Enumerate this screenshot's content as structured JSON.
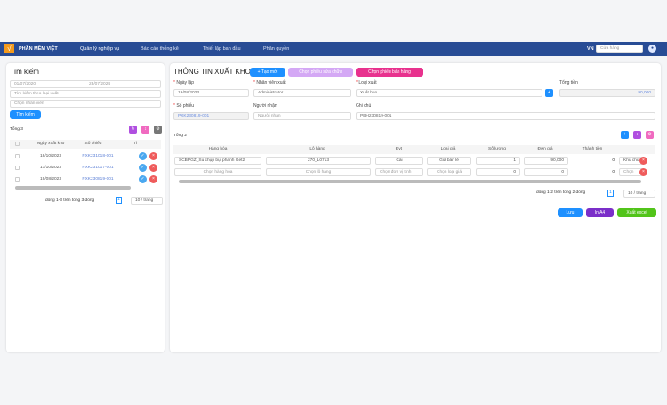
{
  "nav": {
    "brand": "PHẦN MỀM VIỆT",
    "items": [
      "Quản lý nghiệp vụ",
      "Báo cáo thống kê",
      "Thiết lập ban đầu",
      "Phân quyền"
    ],
    "lang": "VN",
    "store_placeholder": "Cửa hàng"
  },
  "left": {
    "title": "Tìm kiếm",
    "date_from": "01/07/2020",
    "date_to": "23/07/2024",
    "type_placeholder": "Tìm kiếm theo loại xuất",
    "staff_placeholder": "Chọn nhân viên",
    "search_button": "Tìm kiếm",
    "total": "Tổng 3",
    "columns": [
      "Ngày xuất kho",
      "Số phiếu",
      "Tì"
    ],
    "rows": [
      {
        "date": "18/10/2023",
        "code": "PXK231018-001"
      },
      {
        "date": "17/10/2023",
        "code": "PXK231017-001"
      },
      {
        "date": "19/08/2023",
        "code": "PXK230819-001"
      }
    ],
    "pagination": "dòng 1-3 trên tổng 3 dòng",
    "page": "1",
    "page_size": "10 / trang"
  },
  "main": {
    "title": "THÔNG TIN XUẤT KHO",
    "new_button": "+ Tạo mới",
    "repair_button": "Chọn phiếu sửa chữa",
    "sale_button": "Chọn phiếu bán hàng",
    "date_label": "Ngày lập",
    "date_value": "19/08/2023",
    "staff_label": "Nhân viên xuất",
    "staff_value": "Administrator",
    "type_label": "Loại xuất",
    "type_value": "Xuất bán",
    "total_label": "Tổng tiền",
    "total_value": "90,000",
    "code_label": "Số phiếu",
    "code_value": "PXK230819-001",
    "receiver_label": "Người nhận",
    "receiver_placeholder": "Người nhận",
    "note_label": "Ghi chú",
    "note_value": "PBH230819-001",
    "count": "Tổng 2",
    "columns": [
      "Hàng hóa",
      "Lô hàng",
      "Đvt",
      "Loại giá",
      "Số lượng",
      "Đơn giá",
      "Thành tiền"
    ],
    "rows": [
      {
        "product": "SCBPGZ_Su chụp bụi phanh Get2",
        "lot": "270_L0713",
        "unit": "Cái",
        "price_type": "Giá bán lẻ",
        "qty": "1",
        "price": "90,000",
        "amount": "0",
        "extra": "Khu chứ"
      },
      {
        "product": "Chọn hàng hóa",
        "lot": "Chọn lô hàng",
        "unit": "Chọn đơn vị tính",
        "price_type": "Chọn loại giá",
        "qty": "0",
        "price": "0",
        "amount": "0",
        "extra": "Chọn"
      }
    ],
    "pagination": "dòng 1-2 trên tổng 2 dòng",
    "page": "1",
    "page_size": "10 / trang",
    "save": "Lưu",
    "print": "In A4",
    "excel": "Xuất excel"
  },
  "colors": {
    "nav": "#284c95",
    "primary": "#1e90ff",
    "purple": "#7b2fc9",
    "pink": "#e8328e",
    "green": "#52c41a",
    "danger": "#ef5b5b"
  }
}
